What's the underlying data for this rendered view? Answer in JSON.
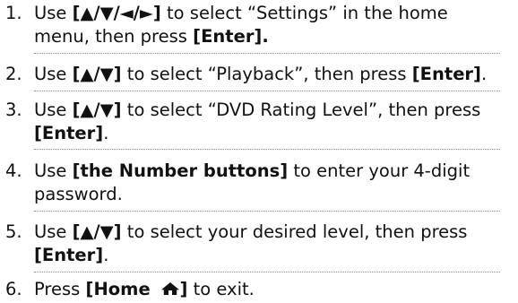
{
  "steps": [
    {
      "number": "1.",
      "t1": "Use ",
      "b1": "[▲/▼/◄/►]",
      "t2": " to select “Settings” in the home",
      "t3": "menu, then press ",
      "b2": "[Enter]."
    },
    {
      "number": "2.",
      "t1": "Use ",
      "b1": "[▲/▼]",
      "t2": " to select “Playback”, then press ",
      "b2": "[Enter]",
      "t3": "."
    },
    {
      "number": "3.",
      "t1": "Use ",
      "b1": "[▲/▼]",
      "t2": " to select “DVD Rating Level”, then press",
      "b2": "[Enter]",
      "t3": "."
    },
    {
      "number": "4.",
      "t1": "Use ",
      "b1": "[the Number buttons]",
      "t2": " to enter your 4-digit",
      "t3": "password."
    },
    {
      "number": "5.",
      "t1": "Use ",
      "b1": "[▲/▼]",
      "t2": " to select your desired level, then press",
      "b2": "[Enter]",
      "t3": "."
    },
    {
      "number": "6.",
      "t1": "Press ",
      "b1": "[Home ",
      "icon": "home-icon",
      "b2": "]",
      "t2": " to exit."
    }
  ]
}
